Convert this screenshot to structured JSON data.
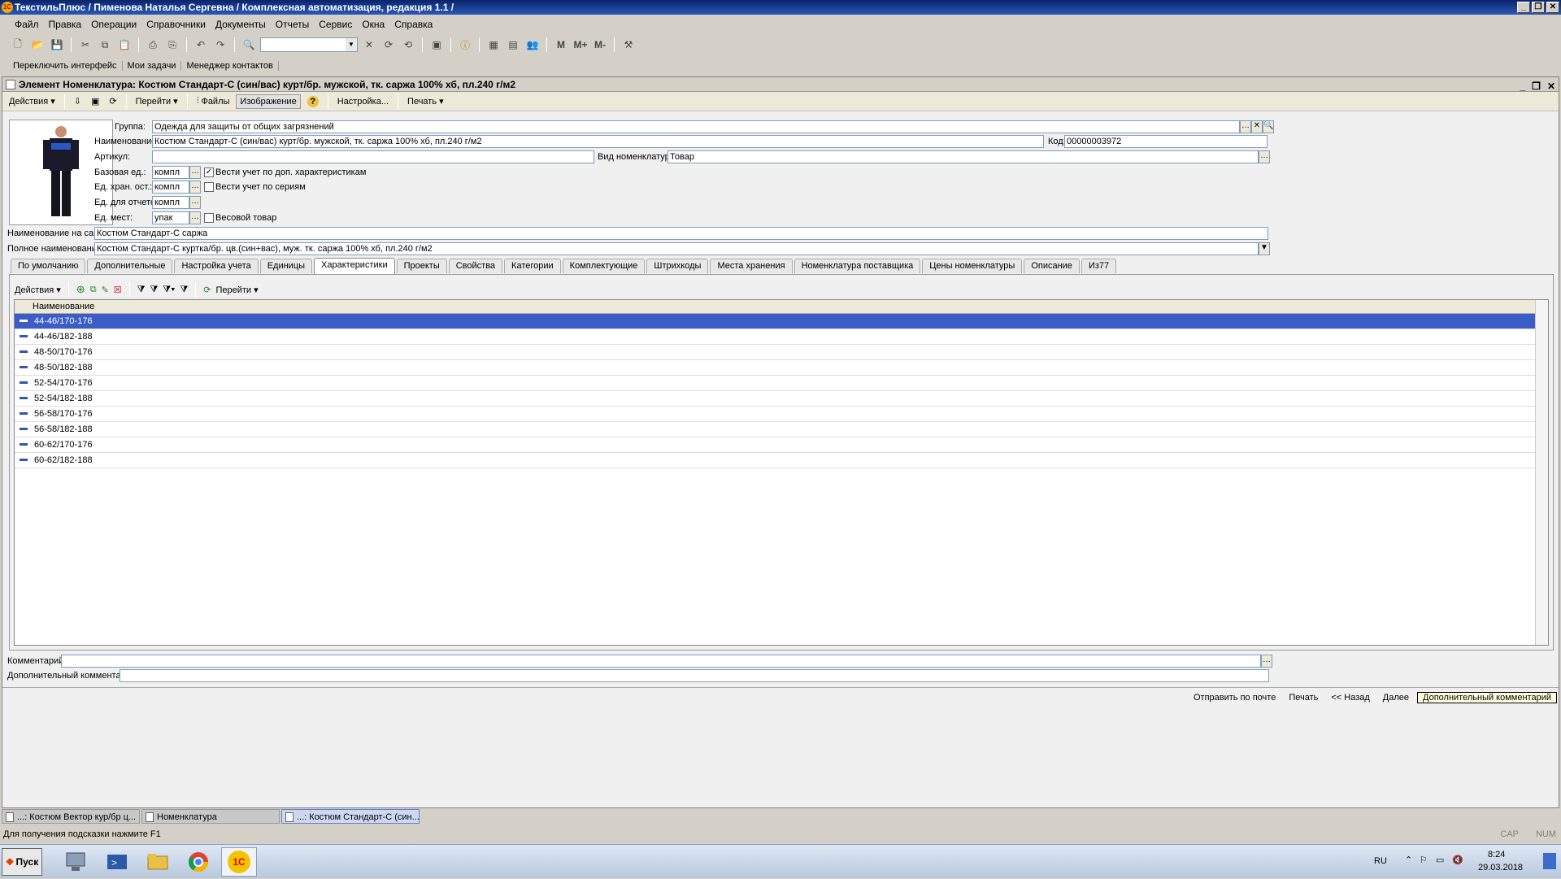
{
  "app": {
    "title": "ТекстильПлюс / Пименова Наталья Сергевна / Комплексная автоматизация, редакция 1.1 /",
    "logo_text": "1С"
  },
  "menu": [
    "Файл",
    "Правка",
    "Операции",
    "Справочники",
    "Документы",
    "Отчеты",
    "Сервис",
    "Окна",
    "Справка"
  ],
  "toolbar": {
    "search_value": "",
    "m_labels": [
      "M",
      "M+",
      "M-"
    ]
  },
  "toolbar2": [
    "Переключить интерфейс",
    "Мои задачи",
    "Менеджер контактов"
  ],
  "doc": {
    "title": "Элемент Номенклатура: Костюм Стандарт-С (син/вас) курт/бр. мужской, тк. саржа 100% хб, пл.240 г/м2",
    "toolbar": {
      "actions": "Действия",
      "goto": "Перейти",
      "files": "Файлы",
      "image": "Изображение",
      "help": "?",
      "settings": "Настройка...",
      "print": "Печать"
    },
    "fields": {
      "group_label": "Группа:",
      "group_value": "Одежда для защиты от общих загрязнений",
      "name_label": "Наименование:",
      "name_value": "Костюм Стандарт-С (син/вас) курт/бр. мужской, тк. саржа 100% хб, пл.240 г/м2",
      "code_label": "Код:",
      "code_value": "00000003972",
      "article_label": "Артикул:",
      "article_value": "",
      "kind_label": "Вид номенклатуры:",
      "kind_value": "Товар",
      "base_unit_label": "Базовая ед.:",
      "base_unit_value": "компл",
      "store_unit_label": "Ед. хран. ост.:",
      "store_unit_value": "компл",
      "report_unit_label": "Ед. для отчетов:",
      "report_unit_value": "компл",
      "place_unit_label": "Ед. мест:",
      "place_unit_value": "упак",
      "chk_characteristics": "Вести учет по доп. характеристикам",
      "chk_characteristics_checked": true,
      "chk_series": "Вести учет по сериям",
      "chk_series_checked": false,
      "chk_weight": "Весовой товар",
      "chk_weight_checked": false,
      "site_name_label": "Наименование на сайт:",
      "site_name_value": "Костюм Стандарт-С саржа",
      "full_name_label": "Полное наименование:",
      "full_name_value": "Костюм Стандарт-С куртка/бр. цв.(син+вас), муж. тк. саржа 100% хб, пл.240 г/м2"
    },
    "tabs": [
      "По умолчанию",
      "Дополнительные",
      "Настройка учета",
      "Единицы",
      "Характеристики",
      "Проекты",
      "Свойства",
      "Категории",
      "Комплектующие",
      "Штрихкоды",
      "Места хранения",
      "Номенклатура поставщика",
      "Цены номенклатуры",
      "Описание",
      "Из77"
    ],
    "active_tab": 4,
    "grid": {
      "actions": "Действия",
      "goto": "Перейти",
      "column": "Наименование",
      "rows": [
        "44-46/170-176",
        "44-46/182-188",
        "48-50/170-176",
        "48-50/182-188",
        "52-54/170-176",
        "52-54/182-188",
        "56-58/170-176",
        "56-58/182-188",
        "60-62/170-176",
        "60-62/182-188"
      ],
      "selected": 0
    },
    "comment_label": "Комментарий:",
    "comment_value": "",
    "add_comment_label": "Дополнительный комментарий:",
    "add_comment_value": "",
    "bottom": {
      "send_mail": "Отправить по почте",
      "print": "Печать",
      "back": "<< Назад",
      "next": "Далее",
      "tooltip": "Дополнительный комментарий"
    }
  },
  "window_tabs": [
    "...: Костюм Вектор кур/бр ц...",
    "Номенклатура",
    "...: Костюм Стандарт-С (син..."
  ],
  "status": {
    "hint": "Для получения подсказки нажмите F1",
    "cap": "CAP",
    "num": "NUM"
  },
  "taskbar": {
    "start": "Пуск",
    "lang": "RU",
    "time": "8:24",
    "date": "29.03.2018"
  },
  "colors": {
    "title_bar": "#0a246a",
    "selection": "#3c5cc8",
    "window_bg": "#d4d0c8"
  }
}
